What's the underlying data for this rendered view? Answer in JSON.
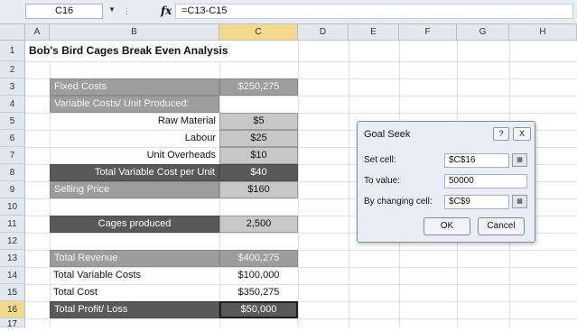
{
  "formula_bar": {
    "name_box": "C16",
    "fx_symbol": "fx",
    "formula": "=C13-C15"
  },
  "columns": [
    "A",
    "B",
    "C",
    "D",
    "E",
    "F",
    "G",
    "H"
  ],
  "rows": [
    "1",
    "2",
    "3",
    "4",
    "5",
    "6",
    "7",
    "8",
    "9",
    "10",
    "11",
    "12",
    "13",
    "14",
    "15",
    "16",
    "17"
  ],
  "sheet": {
    "title": "Bob's Bird Cages Break Even Analysis",
    "fixed_costs_label": "Fixed Costs",
    "fixed_costs_value": "$250,275",
    "variable_costs_label": "Variable Costs/ Unit Produced:",
    "raw_material_label": "Raw Material",
    "raw_material_value": "$5",
    "labour_label": "Labour",
    "labour_value": "$25",
    "unit_overheads_label": "Unit Overheads",
    "unit_overheads_value": "$10",
    "total_variable_label": "Total Variable Cost per Unit",
    "total_variable_value": "$40",
    "selling_price_label": "Selling Price",
    "selling_price_value": "$160",
    "cages_produced_label": "Cages produced",
    "cages_produced_value": "2,500",
    "total_revenue_label": "Total Revenue",
    "total_revenue_value": "$400,275",
    "total_variable_costs_label": "Total Variable Costs",
    "total_variable_costs_value": "$100,000",
    "total_cost_label": "Total Cost",
    "total_cost_value": "$350,275",
    "total_profit_label": "Total Profit/ Loss",
    "total_profit_value": "$50,000"
  },
  "goal_seek": {
    "title": "Goal Seek",
    "help_button": "?",
    "close_button": "X",
    "set_cell_label": "Set cell:",
    "set_cell_value": "$C$16",
    "to_value_label": "To value:",
    "to_value_value": "50000",
    "changing_cell_label": "By changing cell:",
    "changing_cell_value": "$C$9",
    "ok_label": "OK",
    "cancel_label": "Cancel"
  },
  "colors": {
    "header_bg": "#e3e8ef",
    "selected_header": "#f3d98c",
    "gray_fill": "#9d9d9d",
    "dark_fill": "#595959",
    "light_fill": "#c7c7c7"
  }
}
